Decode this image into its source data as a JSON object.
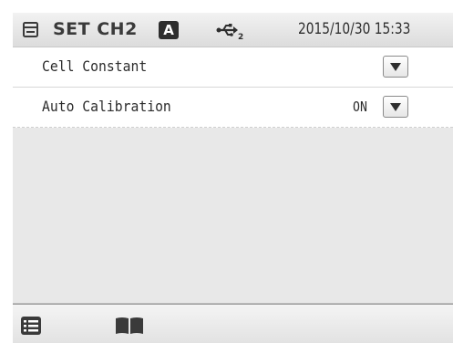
{
  "header": {
    "title": "SET CH2",
    "mode_badge": "A",
    "usb_port": "2",
    "datetime": "2015/10/30 15:33",
    "icons": [
      "setting-sheet-icon",
      "usb-icon"
    ]
  },
  "rows": [
    {
      "label": "Cell Constant",
      "value": "",
      "control": "dropdown"
    },
    {
      "label": "Auto Calibration",
      "value": "ON",
      "control": "dropdown"
    }
  ],
  "footer": {
    "icons": [
      "list-icon",
      "book-icon"
    ]
  },
  "colors": {
    "header_bg": "#e6e6e6",
    "empty_area_bg": "#e8e8e8",
    "badge_bg": "#2e2e2e",
    "text": "#2c2c2c"
  }
}
